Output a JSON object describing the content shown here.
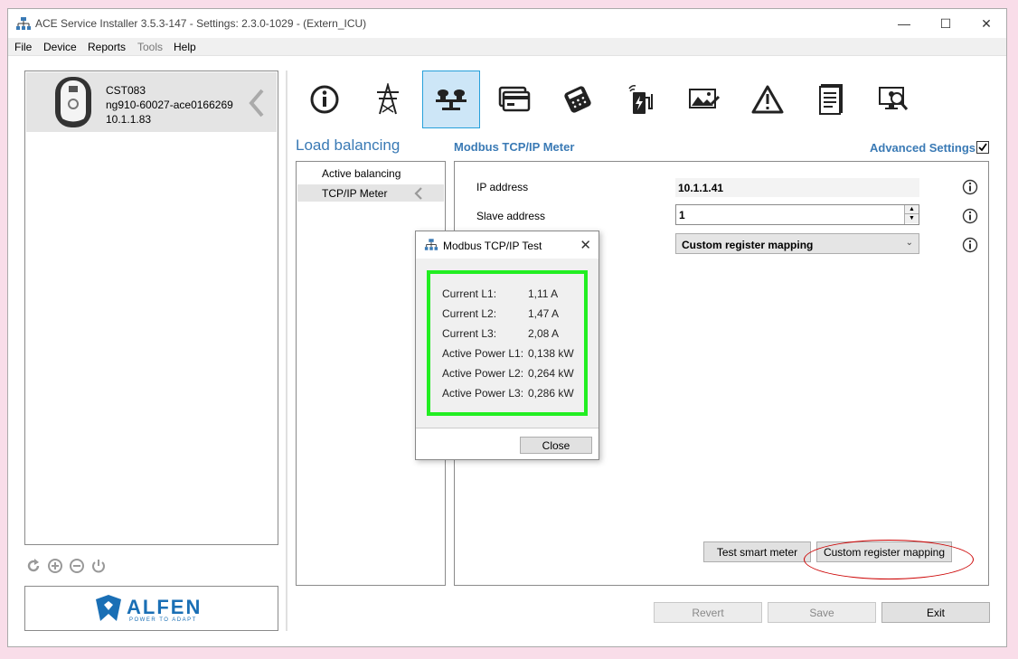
{
  "window": {
    "title": "ACE Service Installer 3.5.3-147 - Settings: 2.3.0-1029 -  (Extern_ICU)"
  },
  "menu": {
    "items": [
      {
        "label": "File",
        "enabled": true
      },
      {
        "label": "Device",
        "enabled": true
      },
      {
        "label": "Reports",
        "enabled": true
      },
      {
        "label": "Tools",
        "enabled": false
      },
      {
        "label": "Help",
        "enabled": true
      }
    ]
  },
  "device": {
    "name": "CST083",
    "id": "ng910-60027-ace0166269",
    "ip": "10.1.1.83"
  },
  "logo": {
    "brand": "ALFEN",
    "tagline": "POWER TO ADAPT"
  },
  "toolbar": {
    "icons": [
      "info-icon",
      "power-tower-icon",
      "load-balancing-icon",
      "card-icon",
      "payment-terminal-icon",
      "ev-charger-icon",
      "display-image-icon",
      "warning-icon",
      "document-icon",
      "diagnostics-monitor-icon"
    ],
    "active_index": 2
  },
  "section": {
    "title": "Load balancing",
    "subtitle": "Modbus TCP/IP Meter",
    "advanced_label": "Advanced Settings",
    "advanced_checked": true
  },
  "lb_menu": {
    "items": [
      "Active balancing",
      "TCP/IP Meter"
    ],
    "selected_index": 1
  },
  "settings": {
    "ip_label": "IP address",
    "ip_value": "10.1.1.41",
    "slave_label": "Slave address",
    "slave_value": "1",
    "mapping_value": "Custom register mapping"
  },
  "buttons": {
    "test_smart_meter": "Test smart meter",
    "custom_register_mapping": "Custom register mapping",
    "revert": "Revert",
    "save": "Save",
    "exit": "Exit"
  },
  "dialog": {
    "title": "Modbus TCP/IP Test",
    "rows": [
      {
        "label": "Current L1:",
        "value": "1,11 A"
      },
      {
        "label": "Current L2:",
        "value": "1,47 A"
      },
      {
        "label": "Current L3:",
        "value": "2,08 A"
      },
      {
        "label": "Active Power L1:",
        "value": "0,138 kW"
      },
      {
        "label": "Active Power L2:",
        "value": "0,264 kW"
      },
      {
        "label": "Active Power L3:",
        "value": "0,286 kW"
      }
    ],
    "close_label": "Close"
  },
  "colors": {
    "accent_blue": "#3a7ab5",
    "active_tab_bg": "#cde6f7",
    "highlight_green": "#22ee22",
    "annotation_red": "#cc0000",
    "logo_blue": "#1a6fb5"
  }
}
